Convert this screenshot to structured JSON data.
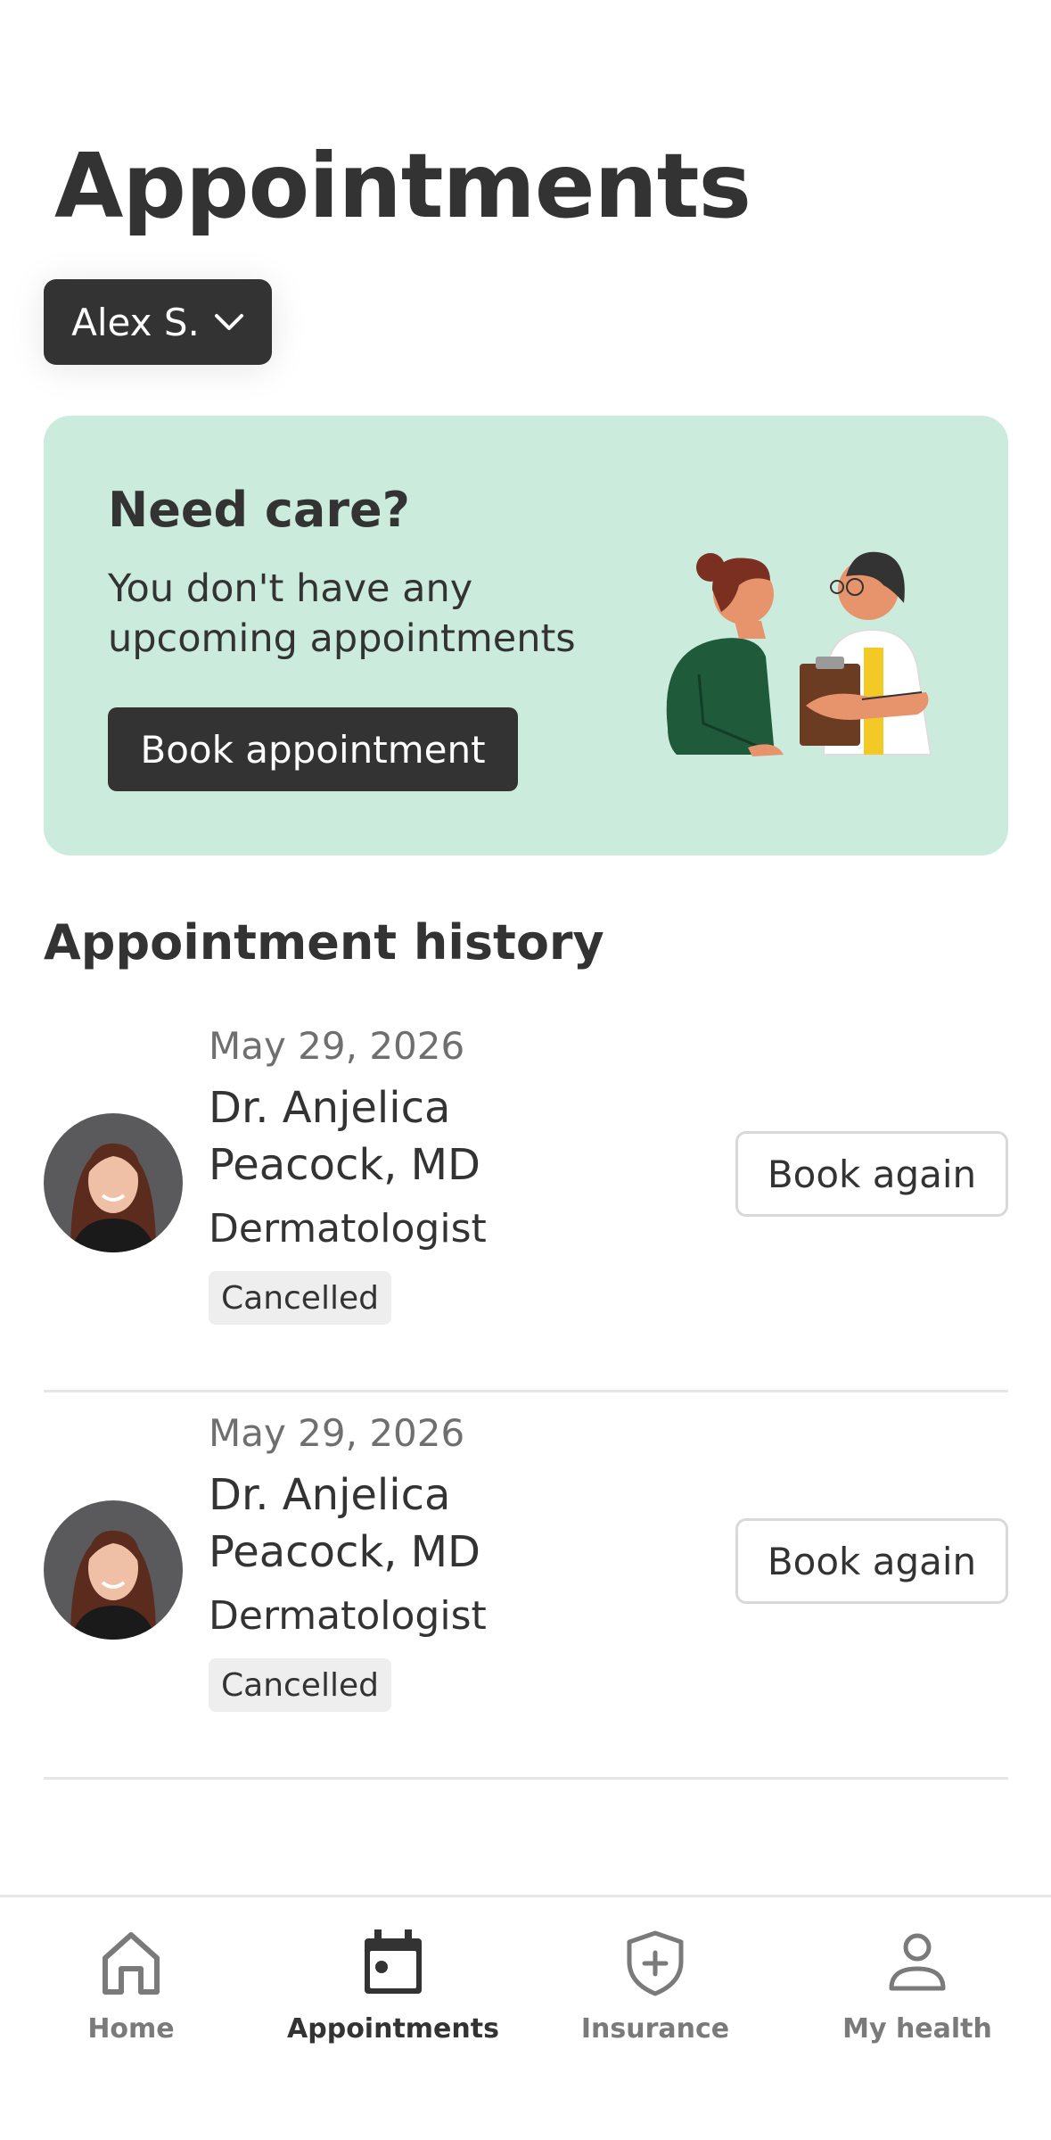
{
  "header": {
    "title": "Appointments"
  },
  "profile": {
    "name": "Alex S."
  },
  "care_card": {
    "title": "Need care?",
    "text": "You don't have any upcoming appointments",
    "button_label": "Book appointment"
  },
  "history": {
    "title": "Appointment history",
    "items": [
      {
        "date": "May 29, 2026",
        "doctor": "Dr. Anjelica Peacock, MD",
        "specialty": "Dermatologist",
        "status": "Cancelled",
        "action_label": "Book again"
      },
      {
        "date": "May 29, 2026",
        "doctor": "Dr. Anjelica Peacock, MD",
        "specialty": "Dermatologist",
        "status": "Cancelled",
        "action_label": "Book again"
      }
    ]
  },
  "nav": {
    "items": [
      {
        "label": "Home",
        "icon": "home-icon"
      },
      {
        "label": "Appointments",
        "icon": "calendar-icon",
        "active": true
      },
      {
        "label": "Insurance",
        "icon": "shield-plus-icon"
      },
      {
        "label": "My health",
        "icon": "person-icon"
      }
    ]
  },
  "colors": {
    "primary_dark": "#333333",
    "card_green": "#cbecdc",
    "badge_bg": "#eeeeee"
  }
}
